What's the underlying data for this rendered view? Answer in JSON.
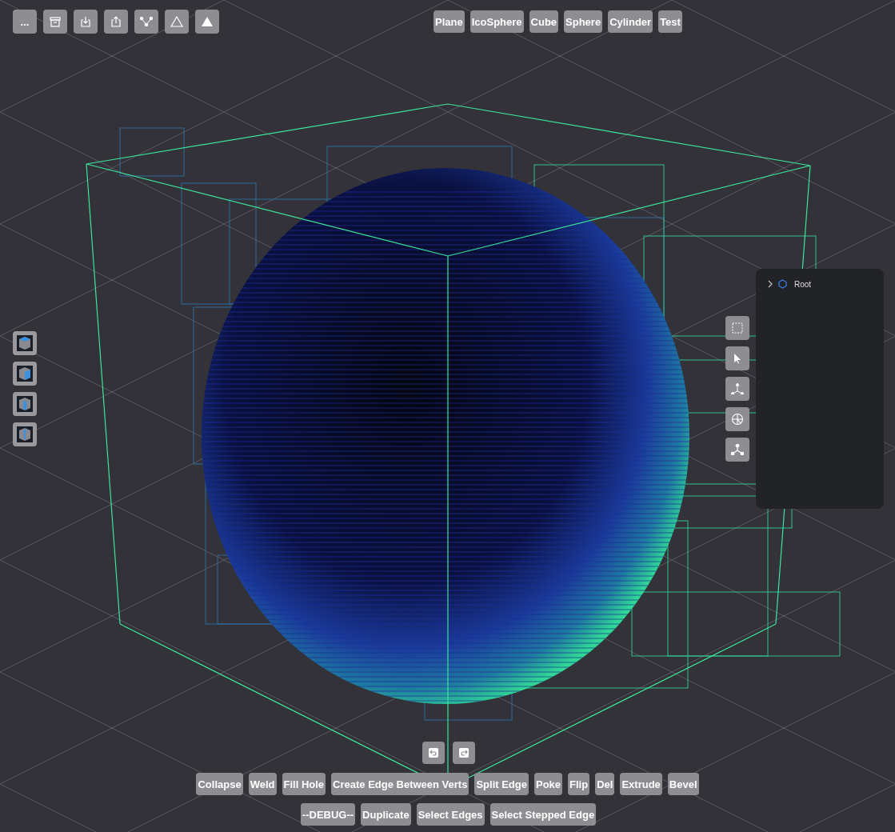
{
  "file_menu": {
    "label": "..."
  },
  "primitives": [
    "Plane",
    "IcoSphere",
    "Cube",
    "Sphere",
    "Cylinder",
    "Test"
  ],
  "scene_tree": [
    {
      "label": "Root",
      "expanded": false
    }
  ],
  "edit_operations": [
    "Collapse",
    "Weld",
    "Fill Hole",
    "Create Edge Between Verts",
    "Split Edge",
    "Poke",
    "Flip",
    "Del",
    "Extrude",
    "Bevel"
  ],
  "debug_operations": [
    "--DEBUG--",
    "Duplicate",
    "Select Edges",
    "Select Stepped Edge"
  ]
}
